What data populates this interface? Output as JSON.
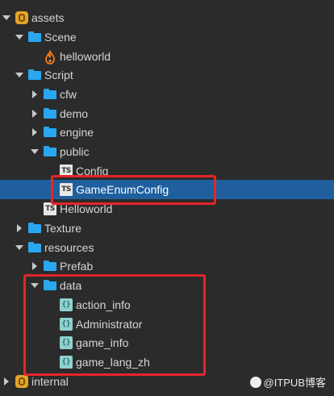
{
  "tree": {
    "assets": "assets",
    "scene": "Scene",
    "helloworld_scene": "helloworld",
    "script": "Script",
    "cfw": "cfw",
    "demo": "demo",
    "engine": "engine",
    "public": "public",
    "config": "Config",
    "game_enum_config": "GameEnumConfig",
    "helloworld_ts": "Helloworld",
    "texture": "Texture",
    "resources": "resources",
    "prefab": "Prefab",
    "data": "data",
    "action_info": "action_info",
    "administrator": "Administrator",
    "game_info": "game_info",
    "game_lang_zh": "game_lang_zh",
    "internal": "internal"
  },
  "icons": {
    "ts": "TS",
    "json": "{}"
  },
  "watermark": "@ITPUB博客",
  "colors": {
    "selection": "#1f5f9e",
    "highlight_border": "#e4252b",
    "folder": "#29a7f0"
  }
}
